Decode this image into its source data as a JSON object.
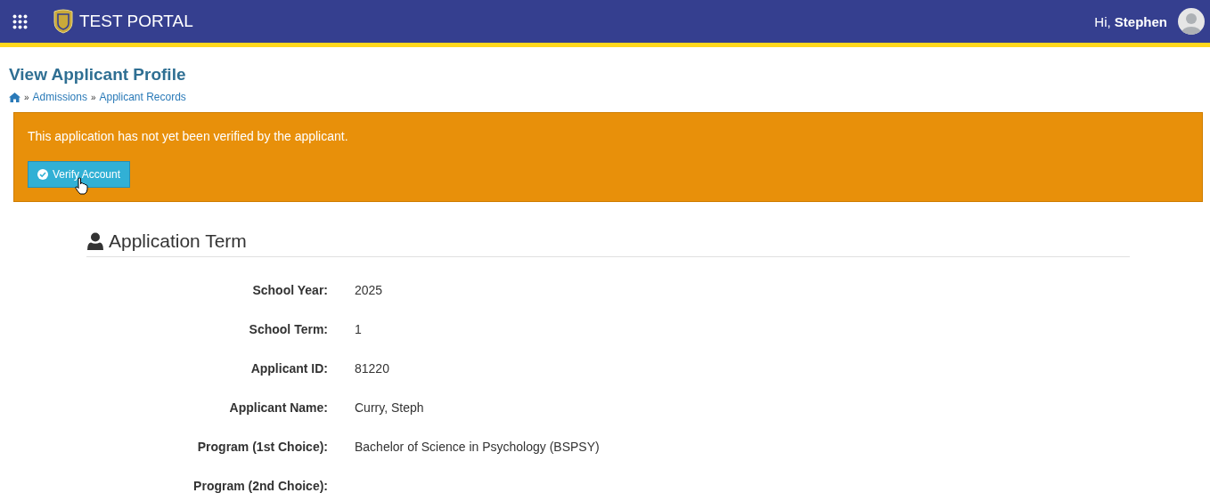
{
  "header": {
    "app_title": "TEST PORTAL",
    "greeting": "Hi,",
    "user_name": "Stephen"
  },
  "page": {
    "title": "View Applicant Profile",
    "breadcrumbs": [
      {
        "separator": "»",
        "label": "Admissions"
      },
      {
        "separator": "»",
        "label": "Applicant Records"
      }
    ]
  },
  "alert": {
    "message": "This application has not yet been verified by the applicant.",
    "button": "Verify Account"
  },
  "section": {
    "title": "Application Term",
    "fields": [
      {
        "label": "School Year:",
        "value": "2025"
      },
      {
        "label": "School Term:",
        "value": "1"
      },
      {
        "label": "Applicant ID:",
        "value": "81220"
      },
      {
        "label": "Applicant Name:",
        "value": "Curry, Steph"
      },
      {
        "label": "Program (1st Choice):",
        "value": "Bachelor of Science in Psychology (BSPSY)"
      },
      {
        "label": "Program (2nd Choice):"
      }
    ]
  }
}
